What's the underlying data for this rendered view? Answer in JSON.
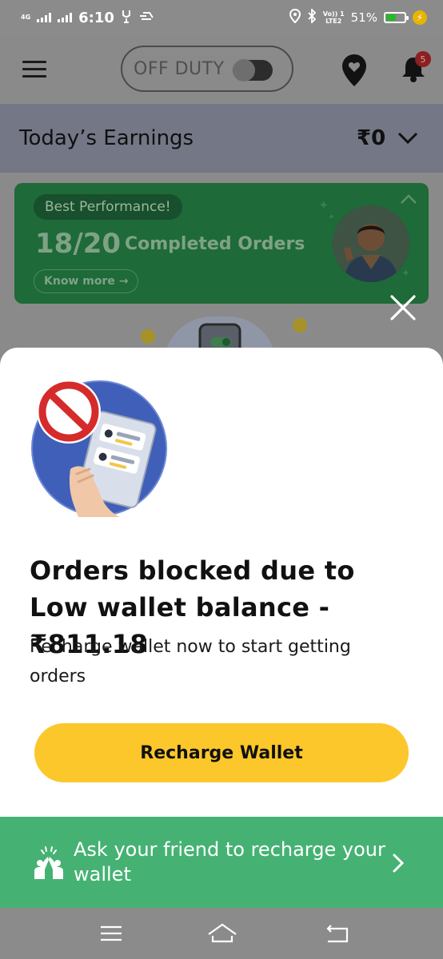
{
  "status_bar": {
    "network": "4G",
    "time": "6:10",
    "carrier": "Vo)) 1",
    "lte": "LTE2",
    "battery": "51%",
    "battery_level": 0.51
  },
  "header": {
    "duty_label": "OFF DUTY",
    "duty_on": false,
    "notification_count": "5"
  },
  "earnings": {
    "title": "Today’s Earnings",
    "value": "₹0"
  },
  "performance_card": {
    "chip": "Best Performance!",
    "count": "18/20",
    "label": "Completed Orders",
    "know_more": "Know more →"
  },
  "sheet": {
    "title": "Orders blocked due to Low wallet balance -₹811.18",
    "subtitle": "Recharge wallet now to start getting orders",
    "primary_button": "Recharge Wallet"
  },
  "friend_banner": {
    "text": "Ask your friend to recharge your wallet"
  },
  "colors": {
    "accent_yellow": "#fcc72a",
    "friend_green": "#45b273",
    "card_green": "#1e6a38"
  }
}
